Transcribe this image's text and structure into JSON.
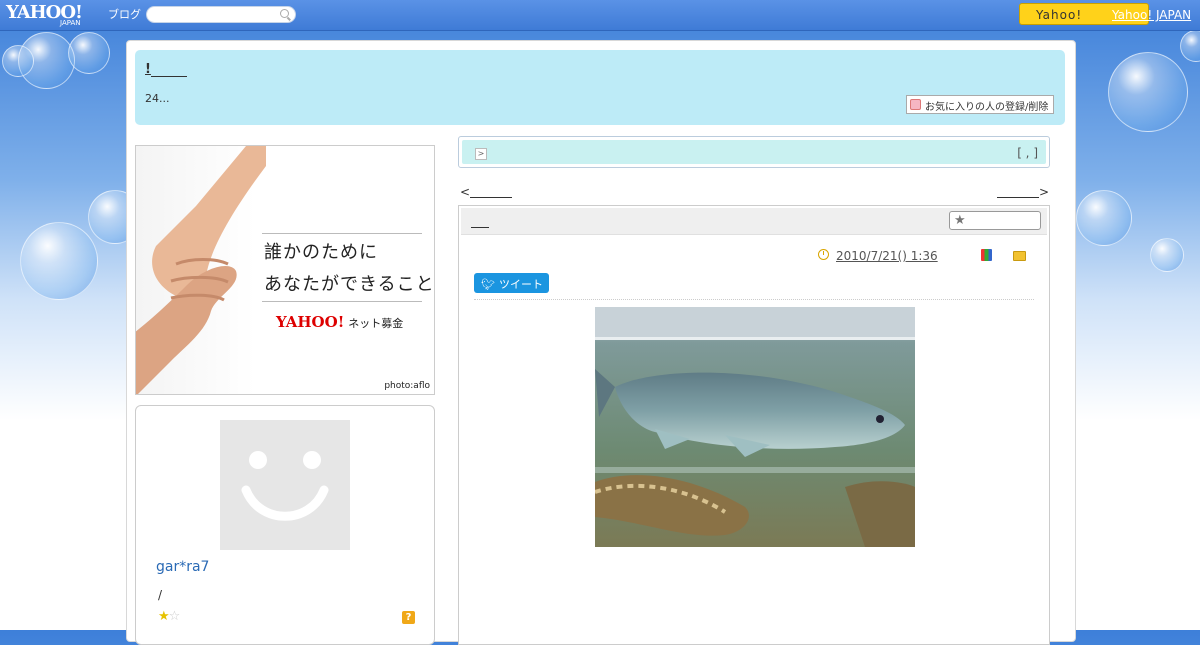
{
  "topbar": {
    "logo_text": "YAHOO!",
    "logo_sub": "JAPAN",
    "logo_product": "ブログ",
    "search_placeholder": "",
    "yahoo_button": "Yahoo!",
    "yahoo_japan_link": "Yahoo! JAPAN"
  },
  "header": {
    "blog_title": "!",
    "blog_description": "24...",
    "favorite_button": "お気に入りの人の登録/削除"
  },
  "ad": {
    "line1": "誰かのために",
    "line2": "あなたができること",
    "logo": "YAHOO!",
    "logo_sub": "ネット募金",
    "credit": "photo:aflo"
  },
  "profile": {
    "username": "gar*ra7",
    "note": "/",
    "help": "?",
    "stars_on": "★",
    "stars_off": "☆"
  },
  "notice": {
    "arrow": ">",
    "bracket": "[ , ]"
  },
  "nav": {
    "prev": "<",
    "next": ">"
  },
  "article": {
    "star_button": "★",
    "date": "2010/7/21()  1:36",
    "tweet": "ツイート"
  },
  "colors": {
    "topbar": "#3f7bd6",
    "header_bg": "#bdebf7",
    "notice_bg": "#c9f1f1",
    "tweet_bg": "#1b95e0",
    "username": "#2a6ab5",
    "yahoo_button": "#ffd21a"
  }
}
